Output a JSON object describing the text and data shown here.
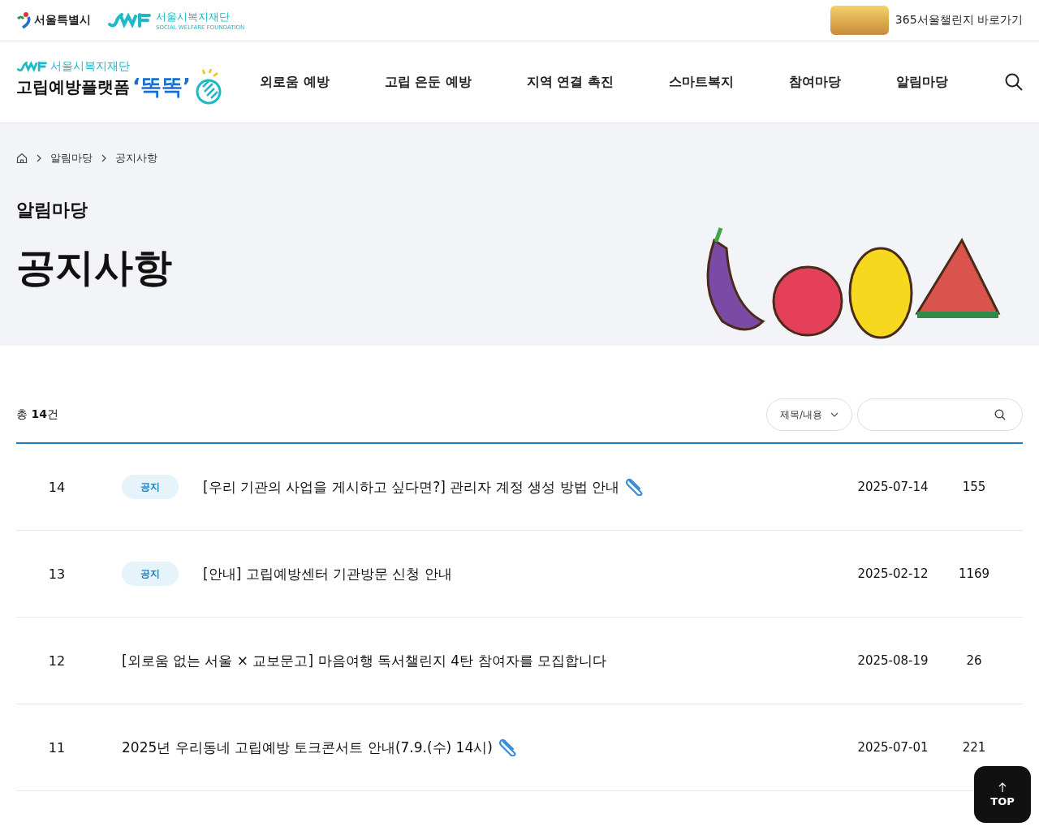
{
  "top_bar": {
    "seoul_logo": "서울특별시",
    "foundation_logo": {
      "name": "서울시복지재단",
      "subtitle": "SOCIAL WELFARE FOUNDATION"
    },
    "challenge_link": "365서울챌린지 바로가기"
  },
  "header": {
    "brand": {
      "org": "서울시복지재단",
      "title": "고립예방플랫폼",
      "highlight": "‘똑똑’"
    },
    "nav": [
      "외로움 예방",
      "고립 은둔 예방",
      "지역 연결 촉진",
      "스마트복지",
      "참여마당",
      "알림마당"
    ]
  },
  "breadcrumb": [
    "알림마당",
    "공지사항"
  ],
  "hero": {
    "section": "알림마당",
    "title": "공지사항"
  },
  "board": {
    "total": "총 **14**건",
    "filter": "제목/내용",
    "rows": [
      {
        "number": "14",
        "tag": "공지",
        "title": "[우리 기관의 사업을 게시하고 싶다면?] 관리자 계정 생성 방법 안내",
        "attachment": true,
        "date": "2025-07-14",
        "views": "155"
      },
      {
        "number": "13",
        "tag": "공지",
        "title": "[안내] 고립예방센터 기관방문 신청 안내",
        "attachment": false,
        "date": "2025-02-12",
        "views": "1169"
      },
      {
        "number": "12",
        "title": "[외로움 없는 서울 × 교보문고] 마음여행 독서챌린지 4탄 참여자를 모집합니다",
        "attachment": false,
        "date": "2025-08-19",
        "views": "26"
      },
      {
        "number": "11",
        "title": "2025년 우리동네 고립예방 토크콘서트 안내(7.9.(수) 14시)",
        "attachment": true,
        "date": "2025-07-01",
        "views": "221"
      }
    ]
  },
  "top_button": "TOP"
}
